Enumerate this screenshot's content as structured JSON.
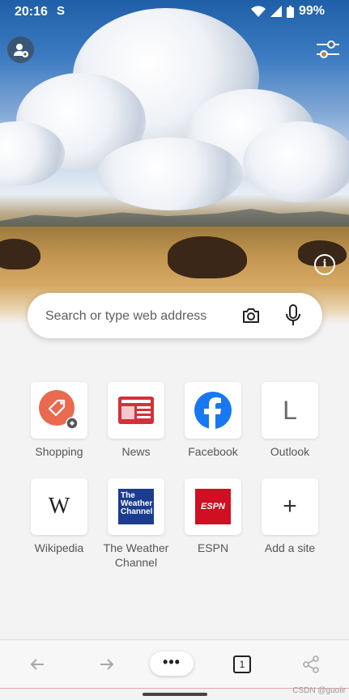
{
  "status_bar": {
    "time": "20:16",
    "battery": "99%"
  },
  "search": {
    "placeholder": "Search or type web address"
  },
  "tiles": [
    {
      "label": "Shopping"
    },
    {
      "label": "News"
    },
    {
      "label": "Facebook"
    },
    {
      "label": "Outlook",
      "glyph": "L"
    },
    {
      "label": "Wikipedia",
      "glyph": "W"
    },
    {
      "label": "The Weather Channel",
      "logo": "The Weather Channel"
    },
    {
      "label": "ESPN",
      "logo": "ESPN"
    },
    {
      "label": "Add a site",
      "glyph": "+"
    }
  ],
  "bottom_bar": {
    "more": "•••",
    "tab_count": "1"
  },
  "watermark": "CSDN @guoiir",
  "colors": {
    "accent": "#1877f2",
    "shopping": "#ea6a4f",
    "news": "#d5303a",
    "weather": "#1b3c8f",
    "espn": "#d00f23"
  }
}
